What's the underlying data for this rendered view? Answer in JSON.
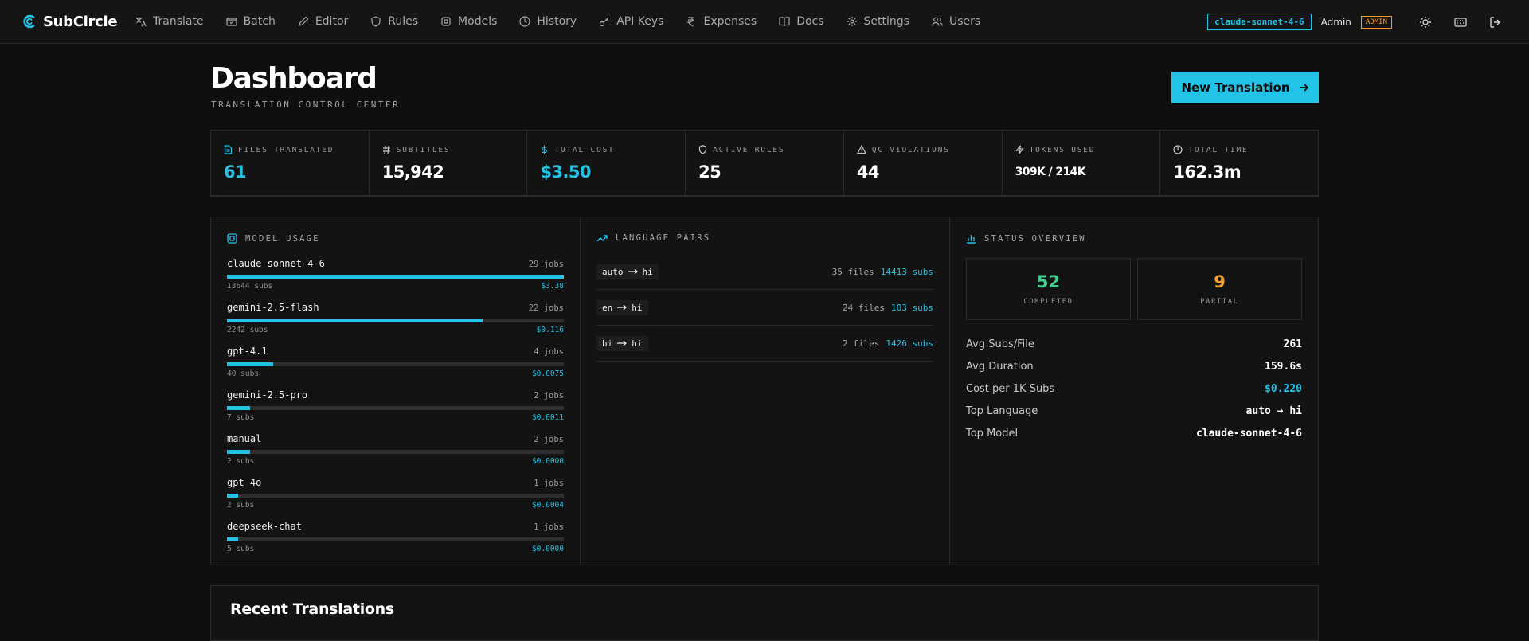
{
  "app": {
    "name": "SubCircle",
    "accent": "#22c3e6"
  },
  "nav": {
    "items": [
      {
        "label": "Translate",
        "icon": "translate-icon"
      },
      {
        "label": "Batch",
        "icon": "batch-icon"
      },
      {
        "label": "Editor",
        "icon": "pencil-icon"
      },
      {
        "label": "Rules",
        "icon": "shield-icon"
      },
      {
        "label": "Models",
        "icon": "chip-icon"
      },
      {
        "label": "History",
        "icon": "clock-icon"
      },
      {
        "label": "API Keys",
        "icon": "key-icon"
      },
      {
        "label": "Expenses",
        "icon": "rupee-icon"
      },
      {
        "label": "Docs",
        "icon": "book-icon"
      },
      {
        "label": "Settings",
        "icon": "gear-icon"
      },
      {
        "label": "Users",
        "icon": "users-icon"
      }
    ],
    "model_chip": "claude-sonnet-4-6",
    "user": "Admin",
    "role_badge": "ADMIN"
  },
  "header": {
    "title": "Dashboard",
    "subtitle": "TRANSLATION CONTROL CENTER",
    "new_button": "New Translation"
  },
  "stats": [
    {
      "label": "FILES TRANSLATED",
      "value": "61",
      "icon": "file-icon",
      "accent": true
    },
    {
      "label": "SUBTITLES",
      "value": "15,942",
      "icon": "hash-icon"
    },
    {
      "label": "TOTAL COST",
      "value": "$3.50",
      "icon": "dollar-icon",
      "accent": true
    },
    {
      "label": "ACTIVE RULES",
      "value": "25",
      "icon": "shield-icon"
    },
    {
      "label": "QC VIOLATIONS",
      "value": "44",
      "icon": "warning-icon"
    },
    {
      "label": "TOKENS USED",
      "value": "309K / 214K",
      "icon": "bolt-icon"
    },
    {
      "label": "TOTAL TIME",
      "value": "162.3m",
      "icon": "clock-icon"
    }
  ],
  "model_usage": {
    "title": "MODEL USAGE",
    "models": [
      {
        "name": "claude-sonnet-4-6",
        "jobs": "29 jobs",
        "subs": "13644 subs",
        "cost": "$3.38",
        "fraction": 1.0
      },
      {
        "name": "gemini-2.5-flash",
        "jobs": "22 jobs",
        "subs": "2242 subs",
        "cost": "$0.116",
        "fraction": 0.76
      },
      {
        "name": "gpt-4.1",
        "jobs": "4 jobs",
        "subs": "40 subs",
        "cost": "$0.0075",
        "fraction": 0.138
      },
      {
        "name": "gemini-2.5-pro",
        "jobs": "2 jobs",
        "subs": "7 subs",
        "cost": "$0.0011",
        "fraction": 0.069
      },
      {
        "name": "manual",
        "jobs": "2 jobs",
        "subs": "2 subs",
        "cost": "$0.0000",
        "fraction": 0.069
      },
      {
        "name": "gpt-4o",
        "jobs": "1 jobs",
        "subs": "2 subs",
        "cost": "$0.0004",
        "fraction": 0.034
      },
      {
        "name": "deepseek-chat",
        "jobs": "1 jobs",
        "subs": "5 subs",
        "cost": "$0.0000",
        "fraction": 0.034
      }
    ]
  },
  "language_pairs": {
    "title": "LANGUAGE PAIRS",
    "pairs": [
      {
        "from": "auto",
        "to": "hi",
        "files": "35 files",
        "subs": "14413 subs"
      },
      {
        "from": "en",
        "to": "hi",
        "files": "24 files",
        "subs": "103 subs"
      },
      {
        "from": "hi",
        "to": "hi",
        "files": "2 files",
        "subs": "1426 subs"
      }
    ]
  },
  "status_overview": {
    "title": "STATUS OVERVIEW",
    "completed": {
      "value": "52",
      "label": "COMPLETED",
      "color": "#3ecf8e"
    },
    "partial": {
      "value": "9",
      "label": "PARTIAL",
      "color": "#f0a030"
    },
    "metrics": [
      {
        "label": "Avg Subs/File",
        "value": "261"
      },
      {
        "label": "Avg Duration",
        "value": "159.6s"
      },
      {
        "label": "Cost per 1K Subs",
        "value": "$0.220",
        "accent": true
      },
      {
        "label": "Top Language",
        "value": "auto → hi"
      },
      {
        "label": "Top Model",
        "value": "claude-sonnet-4-6"
      }
    ]
  },
  "recent": {
    "title": "Recent Translations"
  }
}
